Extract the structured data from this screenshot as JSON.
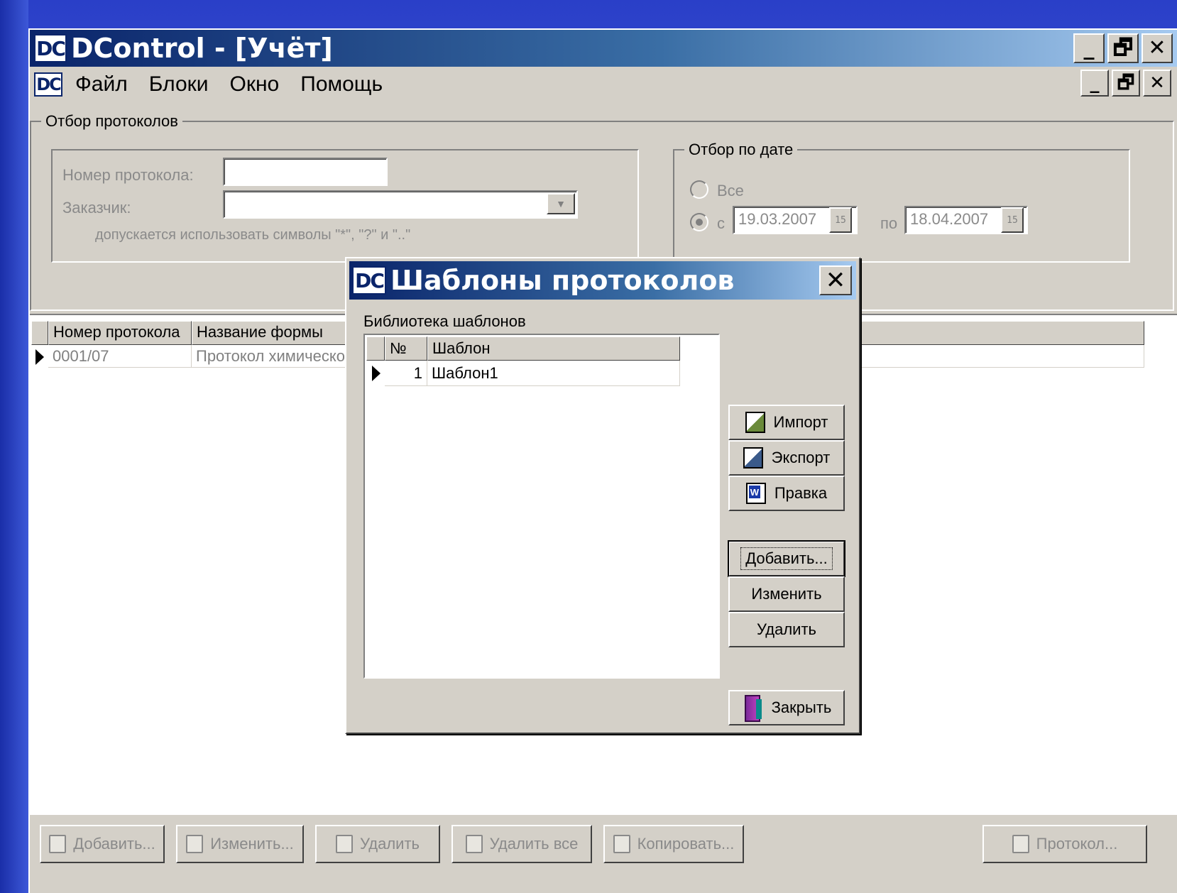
{
  "window": {
    "logo": "DC",
    "title": "DControl - [Учёт]",
    "caption_buttons": {
      "minimize": "_",
      "restore": "🗗",
      "close": "✕"
    }
  },
  "menu": {
    "logo": "DC",
    "items": [
      "Файл",
      "Блоки",
      "Окно",
      "Помощь"
    ]
  },
  "filter": {
    "legend": "Отбор протоколов",
    "protocol_number_label": "Номер протокола:",
    "protocol_number_value": "",
    "customer_label": "Заказчик:",
    "customer_value": "",
    "hint": "допускается использовать символы \"*\", \"?\" и \"..\""
  },
  "date_filter": {
    "legend": "Отбор по дате",
    "all_label": "Все",
    "from_label": "с",
    "from_value": "19.03.2007",
    "to_label": "по",
    "to_value": "18.04.2007",
    "calendar_icon_text": "15",
    "selected": "range"
  },
  "grid": {
    "columns": [
      "Номер протокола",
      "Название формы"
    ],
    "rows": [
      {
        "number": "0001/07",
        "form": "Протокол химическо"
      }
    ]
  },
  "toolbar": {
    "add": "Добавить...",
    "edit": "Изменить...",
    "delete": "Удалить",
    "delete_all": "Удалить все",
    "copy": "Копировать...",
    "protocol": "Протокол..."
  },
  "dialog": {
    "logo": "DC",
    "title": "Шаблоны протоколов",
    "close": "✕",
    "library_label": "Библиотека шаблонов",
    "columns": [
      "№",
      "Шаблон"
    ],
    "rows": [
      {
        "num": "1",
        "name": "Шаблон1"
      }
    ],
    "buttons": {
      "import": "Импорт",
      "export": "Экспорт",
      "edit_word": "Правка",
      "add": "Добавить...",
      "change": "Изменить",
      "delete": "Удалить",
      "close": "Закрыть"
    }
  },
  "colors": {
    "titlebar_start": "#0a246a",
    "titlebar_end": "#a6caf0",
    "face": "#d4d0c8",
    "desktop": "#2a3fc8"
  }
}
